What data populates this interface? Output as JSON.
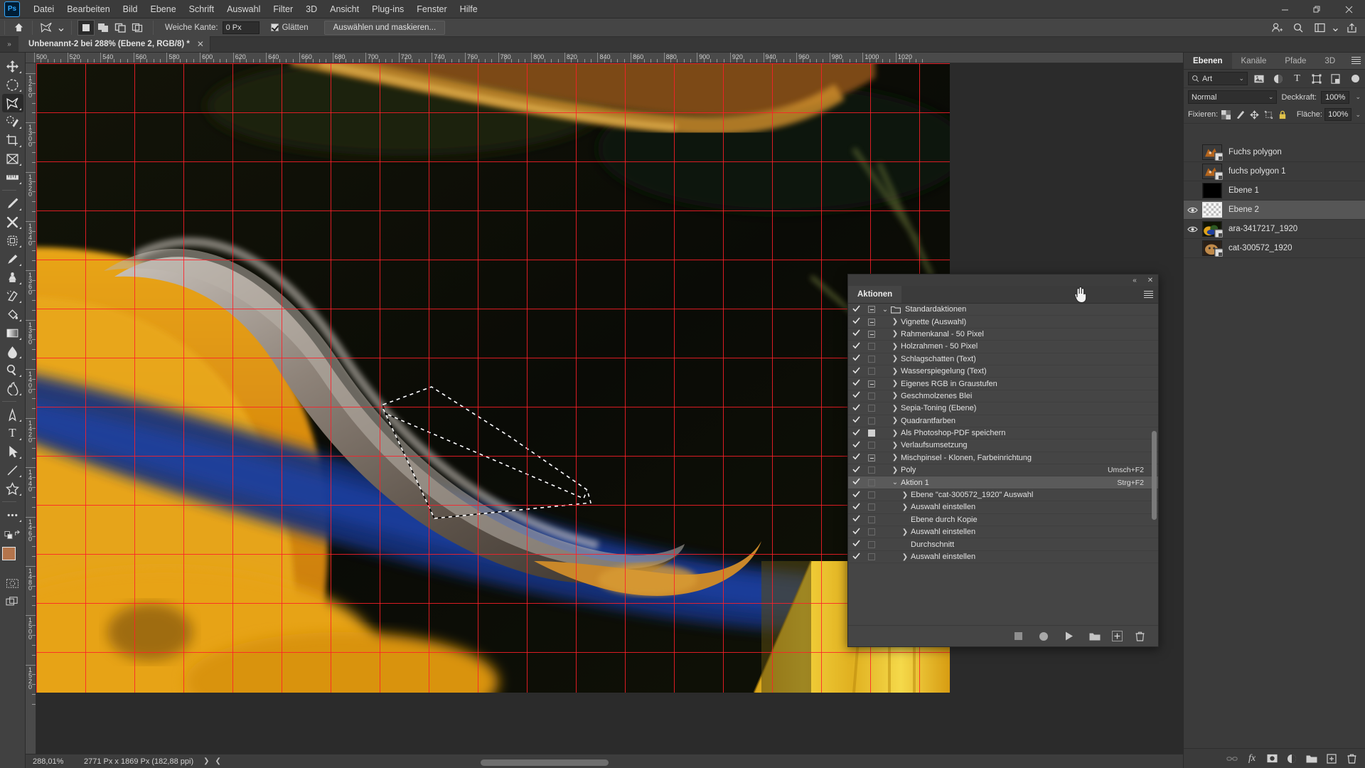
{
  "app": {
    "name": "Ps",
    "logo_color": "#31a8ff"
  },
  "menubar": {
    "items": [
      "Datei",
      "Bearbeiten",
      "Bild",
      "Ebene",
      "Schrift",
      "Auswahl",
      "Filter",
      "3D",
      "Ansicht",
      "Plug-ins",
      "Fenster",
      "Hilfe"
    ],
    "window_controls": {
      "minimize": "—",
      "restore": "❐",
      "close": "✕"
    }
  },
  "optionsbar": {
    "home_icon": "home-icon",
    "tool_icon": "polygonal-lasso-icon",
    "tool_preset_chevron": "⌄",
    "selection_modes": [
      "new-selection",
      "add-to-selection",
      "subtract-from-selection",
      "intersect-selection"
    ],
    "feather_label": "Weiche Kante:",
    "feather_value": "0 Px",
    "antialias_label": "Glätten",
    "antialias_checked": true,
    "select_mask_button": "Auswählen und maskieren...",
    "right_icons": [
      "user-add-icon",
      "search-icon",
      "workspace-icon",
      "chevron-down-icon",
      "share-icon"
    ]
  },
  "tabbar": {
    "collapse_icon": "»",
    "document_title": "Unbenannt-2 bei 288% (Ebene 2, RGB/8) *",
    "close_icon": "✕"
  },
  "toolbar": {
    "tools": [
      {
        "name": "move-tool",
        "glyph": "move"
      },
      {
        "name": "elliptical-marquee-tool",
        "glyph": "ellipse-marquee"
      },
      {
        "name": "polygonal-lasso-tool",
        "glyph": "lasso",
        "selected": true
      },
      {
        "name": "quick-selection-tool",
        "glyph": "quick-select"
      },
      {
        "name": "crop-tool",
        "glyph": "crop"
      },
      {
        "name": "frame-tool",
        "glyph": "frame"
      },
      {
        "name": "ruler-tool",
        "glyph": "ruler"
      },
      {
        "name": "eyedropper-tool",
        "glyph": "eyedropper"
      },
      {
        "name": "healing-brush-tool",
        "glyph": "healing"
      },
      {
        "name": "patch-tool",
        "glyph": "patch"
      },
      {
        "name": "brush-tool",
        "glyph": "brush"
      },
      {
        "name": "clone-stamp-tool",
        "glyph": "stamp"
      },
      {
        "name": "eraser-tool",
        "glyph": "eraser"
      },
      {
        "name": "paint-bucket-tool",
        "glyph": "bucket"
      },
      {
        "name": "gradient-tool",
        "glyph": "gradient"
      },
      {
        "name": "blur-tool",
        "glyph": "blur"
      },
      {
        "name": "dodge-tool",
        "glyph": "dodge"
      },
      {
        "name": "burn-tool",
        "glyph": "burn"
      },
      {
        "name": "pen-tool",
        "glyph": "pen"
      },
      {
        "name": "type-tool",
        "glyph": "T"
      },
      {
        "name": "path-selection-tool",
        "glyph": "arrow"
      },
      {
        "name": "line-tool",
        "glyph": "line"
      },
      {
        "name": "custom-shape-tool",
        "glyph": "shape"
      },
      {
        "name": "more-tools",
        "glyph": "dots"
      }
    ],
    "swap-colors-icon": "swap",
    "default-colors-icon": "default",
    "foreground_color": "#b3744c",
    "background_color": "#ffffff",
    "quickmask_icon": "quick-mask",
    "screenmode_icon": "screen-mode"
  },
  "rulers": {
    "h_start": 492,
    "h_step": 20,
    "h_labels": [
      500,
      520,
      540,
      560,
      580,
      600,
      620,
      640,
      660,
      680,
      700,
      720,
      740,
      760,
      780,
      800,
      820,
      840,
      860,
      880,
      900,
      920,
      940,
      960,
      980,
      1000,
      1020
    ],
    "v_start": 1272,
    "v_step": 20,
    "v_labels": [
      1280,
      1300,
      1320,
      1340,
      1360,
      1380,
      1400,
      1420,
      1440,
      1460,
      1480,
      1500,
      1520
    ],
    "unit": "Px",
    "grid_color": "#ff1e28"
  },
  "statusbar": {
    "zoom": "288,01%",
    "dimensions": "2771 Px x 1869 Px (182,88 ppi)",
    "next_arrow": "❯",
    "prev_arrow": "❮"
  },
  "layers_panel": {
    "tabs": [
      {
        "label": "Ebenen",
        "active": true
      },
      {
        "label": "Kanäle",
        "active": false
      },
      {
        "label": "Pfade",
        "active": false
      },
      {
        "label": "3D",
        "active": false
      }
    ],
    "menu_icon": "panel-menu-icon",
    "filter": {
      "search_icon": "search-icon",
      "kind_label": "Art",
      "chevron": "⌄",
      "icons": [
        "pixel-filter-icon",
        "adjustment-filter-icon",
        "type-filter-icon",
        "shape-filter-icon",
        "smartobject-filter-icon"
      ],
      "toggle": "filter-toggle"
    },
    "blend": {
      "mode": "Normal",
      "chevron": "⌄",
      "opacity_label": "Deckkraft:",
      "opacity_value": "100%"
    },
    "lock": {
      "label": "Fixieren:",
      "icons": [
        "lock-transparency-icon",
        "lock-image-icon",
        "lock-position-icon",
        "lock-artboard-icon",
        "lock-all-icon"
      ],
      "fill_label": "Fläche:",
      "fill_value": "100%"
    },
    "layers": [
      {
        "name": "Fuchs polygon",
        "visible": false,
        "selected": false,
        "thumb": "fox",
        "linked": true
      },
      {
        "name": "fuchs polygon 1",
        "visible": false,
        "selected": false,
        "thumb": "fox",
        "linked": true
      },
      {
        "name": "Ebene 1",
        "visible": false,
        "selected": false,
        "thumb": "black",
        "linked": false
      },
      {
        "name": "Ebene 2",
        "visible": true,
        "selected": true,
        "thumb": "transparent",
        "linked": false
      },
      {
        "name": "ara-3417217_1920",
        "visible": true,
        "selected": false,
        "thumb": "parrot",
        "linked": true
      },
      {
        "name": "cat-300572_1920",
        "visible": false,
        "selected": false,
        "thumb": "cat",
        "linked": true
      }
    ],
    "bottom_icons": [
      "link-layers-icon",
      "layer-style-fx-icon",
      "layer-mask-icon",
      "adjustment-layer-icon",
      "new-group-icon",
      "new-layer-icon",
      "delete-layer-icon"
    ]
  },
  "actions_panel": {
    "title": "Aktionen",
    "collapse_icon": "«",
    "close_icon": "✕",
    "menu_icon": "panel-menu-icon",
    "rows": [
      {
        "label": "Standardaktionen",
        "check": true,
        "modal": "minus",
        "twist": "open",
        "indent": 0,
        "folder": true
      },
      {
        "label": "Vignette (Auswahl)",
        "check": true,
        "modal": "minus",
        "twist": "closed",
        "indent": 1
      },
      {
        "label": "Rahmenkanal - 50 Pixel",
        "check": true,
        "modal": "minus",
        "twist": "closed",
        "indent": 1
      },
      {
        "label": "Holzrahmen - 50 Pixel",
        "check": true,
        "modal": "empty",
        "twist": "closed",
        "indent": 1
      },
      {
        "label": "Schlagschatten (Text)",
        "check": true,
        "modal": "empty",
        "twist": "closed",
        "indent": 1
      },
      {
        "label": "Wasserspiegelung (Text)",
        "check": true,
        "modal": "empty",
        "twist": "closed",
        "indent": 1
      },
      {
        "label": "Eigenes RGB in Graustufen",
        "check": true,
        "modal": "minus",
        "twist": "closed",
        "indent": 1
      },
      {
        "label": "Geschmolzenes Blei",
        "check": true,
        "modal": "empty",
        "twist": "closed",
        "indent": 1
      },
      {
        "label": "Sepia-Toning (Ebene)",
        "check": true,
        "modal": "empty",
        "twist": "closed",
        "indent": 1
      },
      {
        "label": "Quadrantfarben",
        "check": true,
        "modal": "empty",
        "twist": "closed",
        "indent": 1
      },
      {
        "label": "Als Photoshop-PDF speichern",
        "check": true,
        "modal": "plain",
        "twist": "closed",
        "indent": 1
      },
      {
        "label": "Verlaufsumsetzung",
        "check": true,
        "modal": "empty",
        "twist": "closed",
        "indent": 1
      },
      {
        "label": "Mischpinsel - Klonen, Farbeinrichtung",
        "check": true,
        "modal": "minus",
        "twist": "closed",
        "indent": 1
      },
      {
        "label": "Poly",
        "check": true,
        "modal": "empty",
        "twist": "closed",
        "indent": 1,
        "shortcut": "Umsch+F2"
      },
      {
        "label": "Aktion 1",
        "check": true,
        "modal": "empty",
        "twist": "open",
        "indent": 1,
        "shortcut": "Strg+F2",
        "highlight": true
      },
      {
        "label": "Ebene \"cat-300572_1920\" Auswahl",
        "check": true,
        "modal": "empty",
        "twist": "closed",
        "indent": 2
      },
      {
        "label": "Auswahl einstellen",
        "check": true,
        "modal": "empty",
        "twist": "closed",
        "indent": 2
      },
      {
        "label": "Ebene durch Kopie",
        "check": true,
        "modal": "empty",
        "twist": "none",
        "indent": 2
      },
      {
        "label": "Auswahl einstellen",
        "check": true,
        "modal": "empty",
        "twist": "closed",
        "indent": 2
      },
      {
        "label": "Durchschnitt",
        "check": true,
        "modal": "empty",
        "twist": "none",
        "indent": 2
      },
      {
        "label": "Auswahl einstellen",
        "check": true,
        "modal": "empty",
        "twist": "closed",
        "indent": 2
      }
    ],
    "bottom_icons": [
      "stop-icon",
      "record-icon",
      "play-icon",
      "new-set-icon",
      "new-action-icon",
      "delete-action-icon"
    ],
    "cursor": "hand-pointer"
  }
}
